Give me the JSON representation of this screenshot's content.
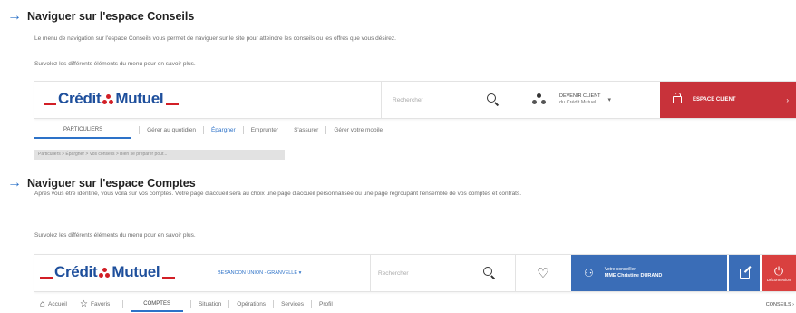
{
  "colors": {
    "accent_blue": "#2d72c8",
    "brand_red": "#d21f26",
    "brand_blue": "#1e4f9c",
    "espace_client_red": "#c8323a",
    "advisor_blue": "#3a6db7",
    "logout_red": "#d9403f"
  },
  "section1": {
    "title": "Naviguer sur l'espace Conseils",
    "text1": "Le menu de navigation sur l'espace Conseils vous permet de naviguer sur le site pour atteindre les conseils ou les offres que vous désirez.",
    "text2": "Survolez les différents éléments du menu pour en savoir plus."
  },
  "header1": {
    "logo": {
      "part1": "Crédit",
      "part2": "Mutuel"
    },
    "search_placeholder": "Rechercher",
    "devenir_client": {
      "line1": "DEVENIR CLIENT",
      "line2": "du Crédit Mutuel"
    },
    "espace_client_label": "ESPACE CLIENT",
    "nav": [
      "PARTICULIERS",
      "Gérer au quotidien",
      "Épargner",
      "Emprunter",
      "S'assurer",
      "Gérer votre mobile"
    ],
    "breadcrumb": "Particuliers > Épargner > Vos conseils > Bien se préparer pour..."
  },
  "section2": {
    "title": "Naviguer sur l'espace Comptes",
    "text1": "Après vous être identifié, vous voilà sur vos comptes. Votre page d'accueil sera au choix une page d'accueil personnalisée ou une page regroupant l'ensemble de vos comptes et contrats.",
    "text2": "Survolez les différents éléments du menu pour en savoir plus."
  },
  "header2": {
    "logo": {
      "part1": "Crédit",
      "part2": "Mutuel"
    },
    "bank_name": "BESANCON UNION - GRANVELLE",
    "search_placeholder": "Rechercher",
    "advisor": {
      "line1": "Votre conseiller",
      "line2": "MME Christine DURAND"
    },
    "logout_label": "Déconnexion",
    "nav": [
      "Accueil",
      "Favoris",
      "COMPTES",
      "Situation",
      "Opérations",
      "Services",
      "Profil"
    ],
    "conseils_label": "CONSEILS"
  }
}
